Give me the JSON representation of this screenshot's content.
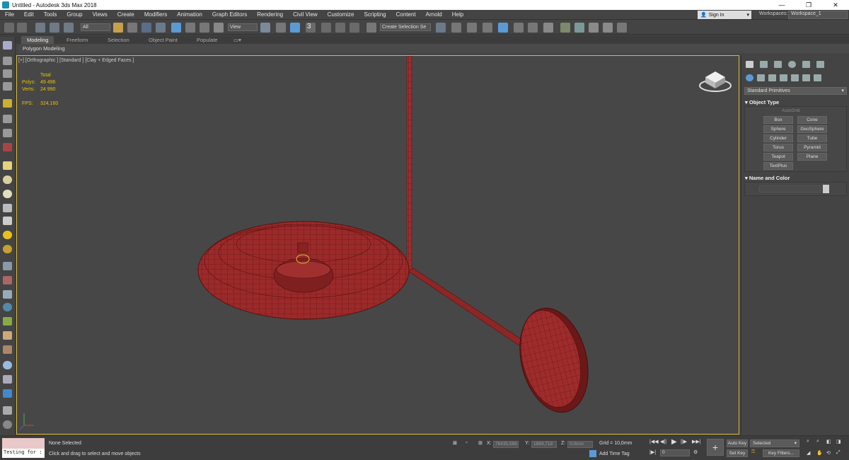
{
  "window": {
    "title": "Untitled - Autodesk 3ds Max 2018",
    "minimize_glyph": "—",
    "maximize_glyph": "❐",
    "close_glyph": "✕"
  },
  "menu": [
    "File",
    "Edit",
    "Tools",
    "Group",
    "Views",
    "Create",
    "Modifiers",
    "Animation",
    "Graph Editors",
    "Rendering",
    "Civil View",
    "Customize",
    "Scripting",
    "Content",
    "Arnold",
    "Help"
  ],
  "header": {
    "signin": "Sign In",
    "workspaces_label": "Workspaces:",
    "workspace_value": "Workspace_1"
  },
  "toolbar": {
    "filter_value": "All",
    "ref_coord_value": "View",
    "selection_set_value": "Create Selection Se",
    "snap_value": "3"
  },
  "ribbon": {
    "tabs": [
      "Modeling",
      "Freeform",
      "Selection",
      "Object Paint",
      "Populate"
    ],
    "active_tab": "Modeling",
    "sub_label": "Polygon Modeling"
  },
  "viewport": {
    "label": "[+] [Orthographic ] [Standard ] [Clay + Edged Faces ]",
    "stats": {
      "header": "Total",
      "polys_label": "Polys:",
      "polys_value": "49 496",
      "verts_label": "Verts:",
      "verts_value": "24 990",
      "fps_label": "FPS:",
      "fps_value": "324,160"
    }
  },
  "command_panel": {
    "category_value": "Standard Primitives",
    "object_type_title": "Object Type",
    "autogrid_label": "AutoGrid",
    "primitives": [
      "Box",
      "Cone",
      "Sphere",
      "GeoSphere",
      "Cylinder",
      "Tube",
      "Torus",
      "Pyramid",
      "Teapot",
      "Plane",
      "TextPlus"
    ],
    "name_color_title": "Name and Color"
  },
  "status": {
    "maxscript_text": "Testing for :",
    "selection_status": "None Selected",
    "prompt": "Click and drag to select and move objects",
    "x_label": "X:",
    "x_value": "76435,586",
    "y_label": "Y:",
    "y_value": "1884,718",
    "z_label": "Z:",
    "z_value": "0,0mm",
    "grid": "Grid = 10,0mm",
    "add_time_tag": "Add Time Tag",
    "frame_value": "0",
    "auto_key": "Auto Key",
    "set_key": "Set Key",
    "key_mode_value": "Selected",
    "key_filters": "Key Filters..."
  },
  "colors": {
    "accent_blue": "#5b9bd5",
    "viewport_border": "#d8b832",
    "model_red": "#9b2a2a",
    "stats_yellow": "#e8c400"
  }
}
